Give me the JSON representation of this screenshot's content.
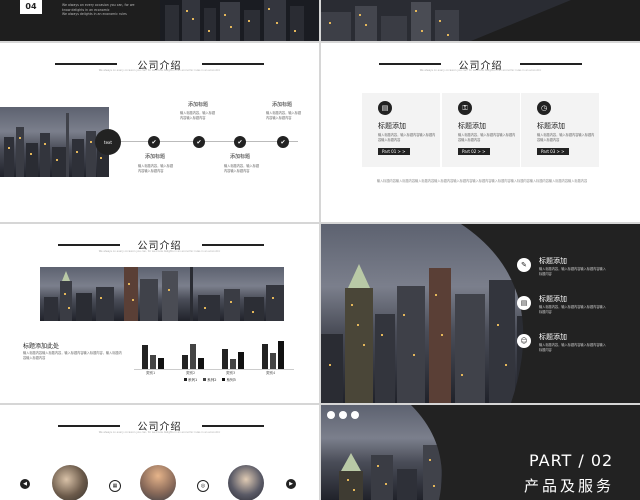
{
  "slide1": {
    "number": "04",
    "desc_lines": [
      "We always on every occasion you can, for we know delights in an economic",
      "We always delights in an economic rules"
    ]
  },
  "slide3": {
    "title": "公司介绍",
    "subtitle": "We always on every occasion you can, for we know delights in an economic rules in an economic",
    "center_label": "text",
    "points": [
      {
        "label": "添加标题",
        "text": "输入标题内容，输入标题内容输入标题内容"
      },
      {
        "label": "添加标题",
        "text": "输入标题内容，输入标题内容输入标题内容"
      },
      {
        "label": "添加标题",
        "text": "输入标题内容，输入标题内容输入标题内容"
      },
      {
        "label": "添加标题",
        "text": "输入标题内容，输入标题内容输入标题内容"
      }
    ]
  },
  "slide4": {
    "title": "公司介绍",
    "subtitle": "We always on every occasion you can, for we know delights in an economic rules in an economic",
    "cards": [
      {
        "icon": "message-icon",
        "title": "标题添加",
        "text": "输入标题内容，输入标题内容输入标题内容输入标题内容",
        "part": "Part 01 > >"
      },
      {
        "icon": "key-icon",
        "title": "标题添加",
        "text": "输入标题内容，输入标题内容输入标题内容输入标题内容",
        "part": "Part 02 > >"
      },
      {
        "icon": "clock-icon",
        "title": "标题添加",
        "text": "输入标题内容，输入标题内容输入标题内容输入标题内容",
        "part": "Part 03 > >"
      }
    ],
    "footer": "输入标题内容输入标题内容输入标题内容输入标题内容输入标题内容输入标题内容输入标题内容输入标题内容输入标题内容输入标题内容输入标题内容"
  },
  "slide5": {
    "title": "公司介绍",
    "subtitle": "We always on every occasion you can, for we know delights in an economic rules in an economic",
    "left_title": "标题添加此处",
    "left_text": "输入标题内容输入标题内容，输入标题内容输入标题内容，输入标题内容输入标题内容",
    "chart_data": {
      "type": "bar",
      "categories": [
        "类别1",
        "类别2",
        "类别3",
        "类别4"
      ],
      "series": [
        {
          "name": "系列1",
          "values": [
            4.3,
            2.5,
            3.5,
            4.5
          ]
        },
        {
          "name": "系列2",
          "values": [
            2.4,
            4.4,
            1.8,
            2.8
          ]
        },
        {
          "name": "系列3",
          "values": [
            2,
            2,
            3,
            5
          ]
        }
      ],
      "ylim": [
        0,
        6
      ],
      "colors": [
        "#222222",
        "#222222",
        "#222222"
      ]
    }
  },
  "slide6": {
    "items": [
      {
        "icon": "pen-icon",
        "title": "标题添加",
        "text": "输入标题内容，输入标题内容输入标题内容输入标题内容"
      },
      {
        "icon": "chat-icon",
        "title": "标题添加",
        "text": "输入标题内容，输入标题内容输入标题内容输入标题内容"
      },
      {
        "icon": "person-icon",
        "title": "标题添加",
        "text": "输入标题内容，输入标题内容输入标题内容输入标题内容"
      }
    ]
  },
  "slide7": {
    "title": "公司介绍",
    "subtitle": "We always on every occasion you can, for we know delights in an economic rules in an economic"
  },
  "slide8": {
    "part": "PART / 02",
    "heading": "产品及服务"
  }
}
